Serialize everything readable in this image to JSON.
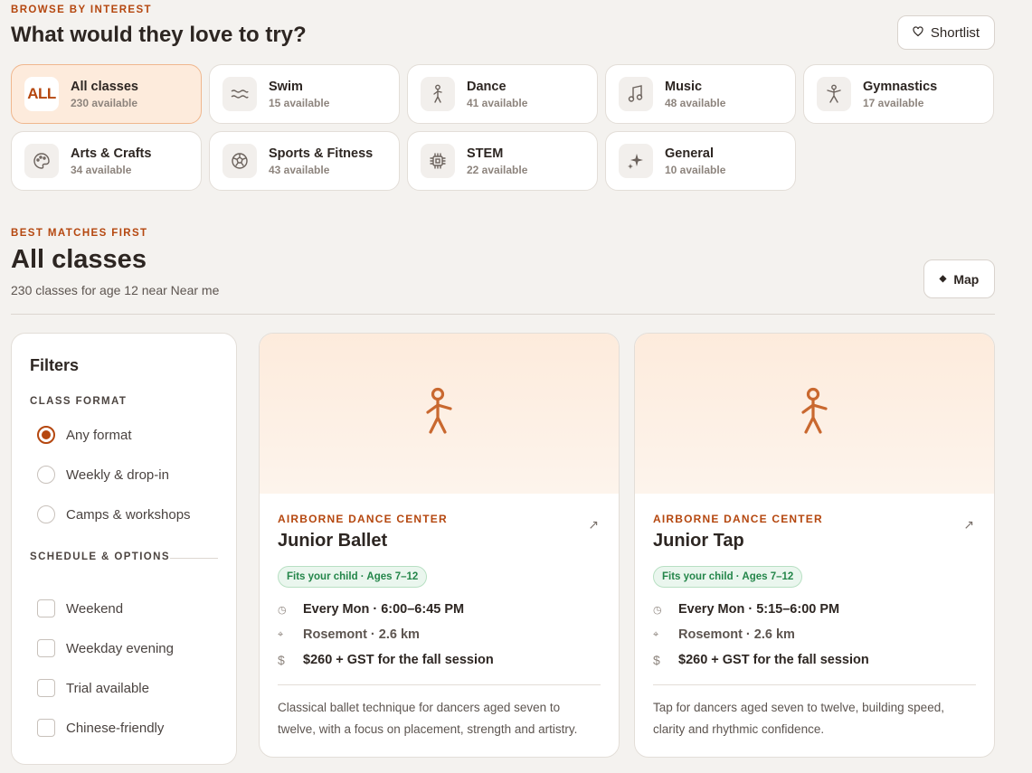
{
  "browse": {
    "eyebrow": "BROWSE BY INTEREST",
    "title": "What would they love to try?",
    "shortlist_label": "Shortlist"
  },
  "categories": [
    {
      "icon": "all-icon",
      "icon_text": "ALL",
      "name": "All classes",
      "count": "230 available",
      "active": true
    },
    {
      "icon": "swim-icon",
      "name": "Swim",
      "count": "15 available"
    },
    {
      "icon": "dance-icon",
      "name": "Dance",
      "count": "41 available"
    },
    {
      "icon": "music-note-icon",
      "name": "Music",
      "count": "48 available"
    },
    {
      "icon": "gymnastics-icon",
      "name": "Gymnastics",
      "count": "17 available"
    },
    {
      "icon": "palette-icon",
      "name": "Arts & Crafts",
      "count": "34 available"
    },
    {
      "icon": "ball-icon",
      "name": "Sports & Fitness",
      "count": "43 available"
    },
    {
      "icon": "chip-icon",
      "name": "STEM",
      "count": "22 available"
    },
    {
      "icon": "sparkle-icon",
      "name": "General",
      "count": "10 available"
    }
  ],
  "results": {
    "eyebrow": "BEST MATCHES FIRST",
    "title": "All classes",
    "subtitle": "230 classes for age 12 near Near me",
    "map_label": "Map"
  },
  "filters": {
    "title": "Filters",
    "format_heading": "CLASS FORMAT",
    "format_options": [
      "Any format",
      "Weekly & drop-in",
      "Camps & workshops"
    ],
    "format_selected": 0,
    "schedule_heading": "SCHEDULE & OPTIONS",
    "schedule_options": [
      "Weekend",
      "Weekday evening",
      "Trial available",
      "Chinese-friendly"
    ]
  },
  "classes": [
    {
      "provider": "AIRBORNE DANCE CENTER",
      "title": "Junior Ballet",
      "badge": "Fits your child · Ages 7–12",
      "schedule": "Every Mon · 6:00–6:45 PM",
      "location": "Rosemont · 2.6 km",
      "price_symbol": "$",
      "price": "$260 + GST for the fall session",
      "description": "Classical ballet technique for dancers aged seven to twelve, with a focus on placement, strength and artistry."
    },
    {
      "provider": "AIRBORNE DANCE CENTER",
      "title": "Junior Tap",
      "badge": "Fits your child · Ages 7–12",
      "schedule": "Every Mon · 5:15–6:00 PM",
      "location": "Rosemont · 2.6 km",
      "price_symbol": "$",
      "price": "$260 + GST for the fall session",
      "description": "Tap for dancers aged seven to twelve, building speed, clarity and rhythmic confidence."
    }
  ],
  "colors": {
    "accent": "#b5470f",
    "badge_green": "#24864a",
    "background": "#f4f2ef"
  }
}
